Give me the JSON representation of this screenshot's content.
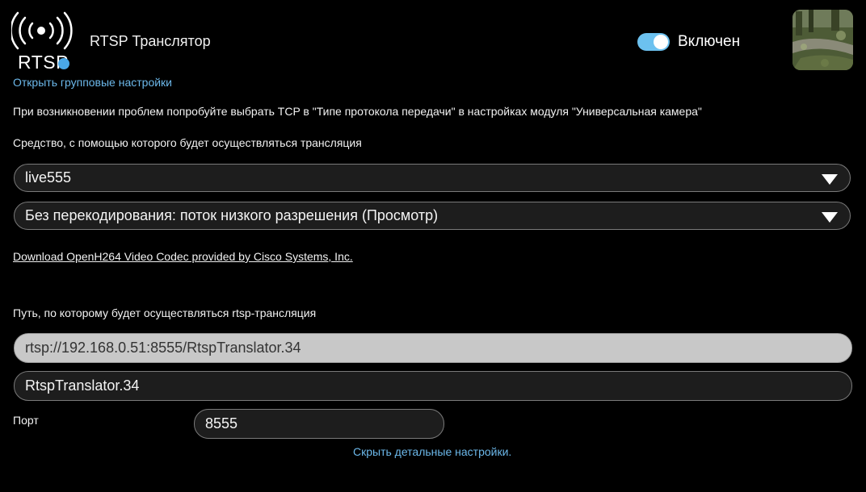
{
  "header": {
    "logo_text": "RTSP",
    "title": "RTSP Транслятор",
    "toggle_label": "Включен",
    "toggle_on": true,
    "accent_color": "#6cc1ef"
  },
  "links": {
    "group_settings": "Открыть групповые настройки",
    "codec_download": "Download OpenH264 Video Codec provided by Cisco Systems, Inc.",
    "hide_details": "Скрыть детальные настройки."
  },
  "hint": "При возникновении проблем попробуйте выбрать TCP в \"Типе протокола передачи\" в настройках модуля \"Универсальная камера\"",
  "means": {
    "label": "Средство, с помощью которого будет осуществляться трансляция",
    "selected": "live555",
    "encoding_selected": "Без перекодирования: поток низкого разрешения (Просмотр)"
  },
  "path": {
    "label": "Путь, по которому будет осуществляться rtsp-трансляция",
    "url": "rtsp://192.168.0.51:8555/RtspTranslator.34",
    "name": "RtspTranslator.34"
  },
  "port": {
    "label": "Порт",
    "value": "8555"
  }
}
